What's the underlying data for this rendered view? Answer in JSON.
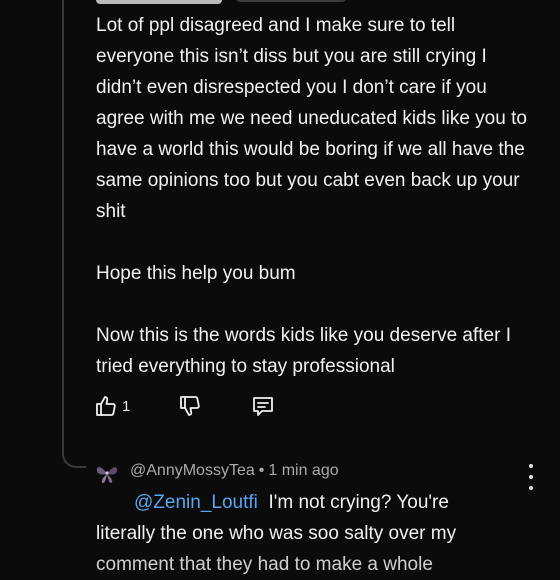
{
  "comment": {
    "paragraph1": "Lot of ppl disagreed and I make sure to tell everyone this isn’t diss but you are still crying I didn’t even disrespected you I don’t care if you agree with me we need uneducated kids like you to have a world this would be boring if we all have the same opinions too but you cabt even back up your shit",
    "paragraph2": "Hope this help you bum",
    "paragraph3": "Now this is the words kids like you deserve after I tried everything to stay professional",
    "like_count": "1"
  },
  "reply": {
    "author": "@AnnyMossyTea",
    "separator": "•",
    "time": "1 min ago",
    "mention": "@Zenin_Loutfi",
    "text_line1": "I'm not crying? You're",
    "text_line2": "literally the one who was soo salty over my",
    "text_line3": "comment that they had to make a whole"
  },
  "icons": {
    "like": "thumbs-up-icon",
    "dislike": "thumbs-down-icon",
    "reply": "comment-icon",
    "more": "more-vertical-icon"
  },
  "colors": {
    "background": "#0b0b0b",
    "text": "#f1f1f1",
    "meta": "#a9a9a9",
    "mention": "#5aa5f0"
  }
}
